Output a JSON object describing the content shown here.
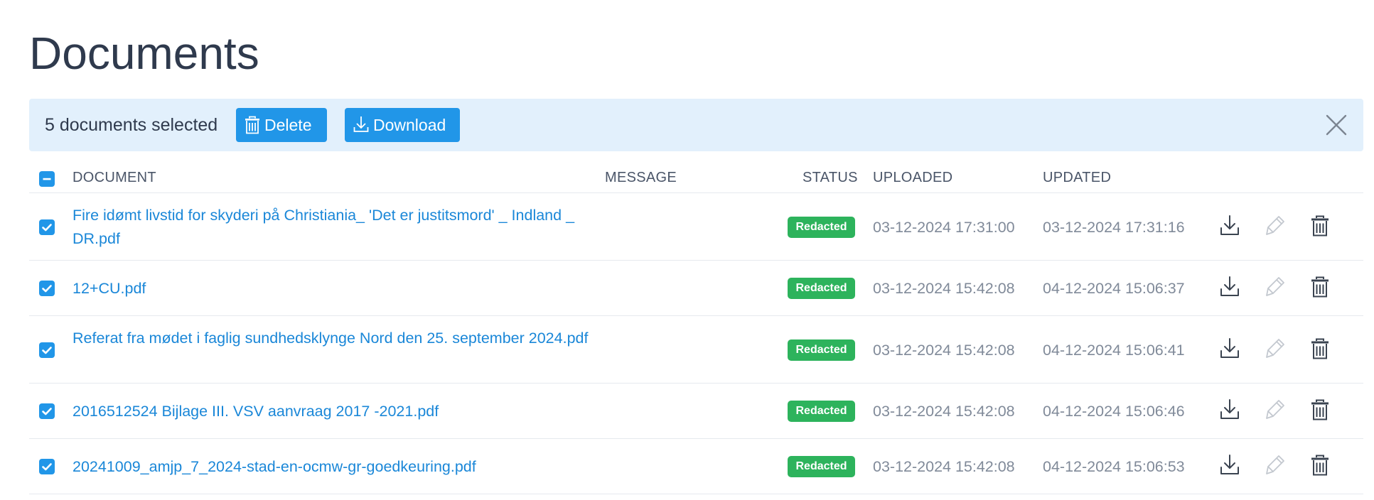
{
  "page": {
    "title": "Documents"
  },
  "selection_bar": {
    "count_text": "5 documents selected",
    "delete_label": "Delete",
    "download_label": "Download"
  },
  "table": {
    "headers": {
      "document": "DOCUMENT",
      "message": "MESSAGE",
      "status": "STATUS",
      "uploaded": "UPLOADED",
      "updated": "UPDATED"
    },
    "rows": [
      {
        "document": "Fire idømt livstid for skyderi på Christiania_ 'Det er justitsmord' _ Indland _ DR.pdf",
        "message": "",
        "status": "Redacted",
        "uploaded": "03-12-2024 17:31:00",
        "updated": "03-12-2024 17:31:16",
        "checked": true
      },
      {
        "document": "12+CU.pdf",
        "message": "",
        "status": "Redacted",
        "uploaded": "03-12-2024 15:42:08",
        "updated": "04-12-2024 15:06:37",
        "checked": true
      },
      {
        "document": "Referat fra mødet i faglig sundhedsklynge Nord den 25. september 2024.pdf",
        "message": "",
        "status": "Redacted",
        "uploaded": "03-12-2024 15:42:08",
        "updated": "04-12-2024 15:06:41",
        "checked": true
      },
      {
        "document": "2016512524 Bijlage III. VSV aanvraag 2017 -2021.pdf",
        "message": "",
        "status": "Redacted",
        "uploaded": "03-12-2024 15:42:08",
        "updated": "04-12-2024 15:06:46",
        "checked": true
      },
      {
        "document": "20241009_amjp_7_2024-stad-en-ocmw-gr-goedkeuring.pdf",
        "message": "",
        "status": "Redacted",
        "uploaded": "03-12-2024 15:42:08",
        "updated": "04-12-2024 15:06:53",
        "checked": true
      }
    ]
  },
  "icons": {
    "select_all": "minus-icon",
    "row_checkbox": "checkmark-icon",
    "row_download": "download-icon",
    "row_edit": "pencil-icon",
    "row_delete": "trash-icon",
    "close": "close-icon"
  },
  "colors": {
    "accent": "#2196e8",
    "link": "#1a87d8",
    "status_redacted": "#2db35c",
    "selection_bar_bg": "#e2f0fc",
    "edit_icon_disabled": "#c3c8cf"
  }
}
